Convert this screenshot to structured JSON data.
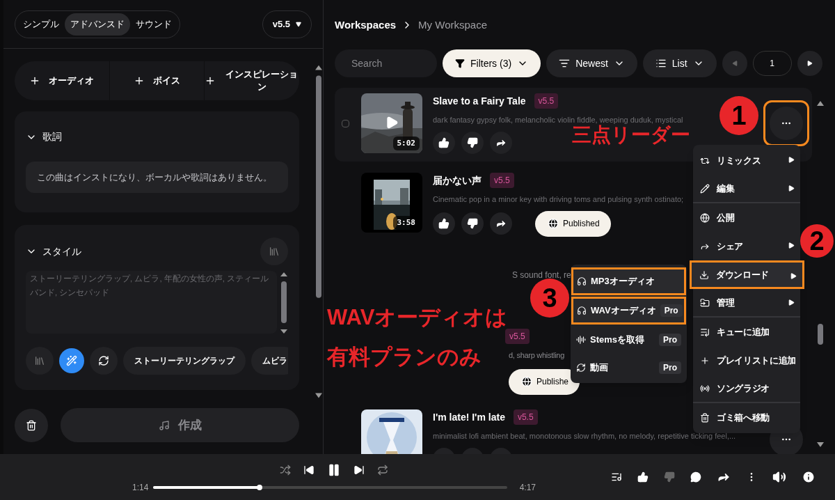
{
  "left_panel": {
    "modes": [
      {
        "label": "シンプル",
        "selected": false
      },
      {
        "label": "アドバンスド",
        "selected": true
      },
      {
        "label": "サウンド",
        "selected": false
      }
    ],
    "model_select": "v5.5",
    "add_buttons": [
      {
        "label": "オーディオ"
      },
      {
        "label": "ボイス"
      },
      {
        "label": "インスピレーション"
      }
    ],
    "lyrics": {
      "title": "歌詞",
      "expanded": true,
      "value": "この曲はインストになり、ボーカルや歌詞はありません。"
    },
    "style": {
      "title": "スタイル",
      "expanded": true,
      "placeholder": "ストーリーテリングラップ, ムビラ, 年配の女性の声, スティールバンド, シンセパッド",
      "tags": [
        "ストーリーテリングラップ",
        "ムビラ"
      ]
    },
    "create_button": "作成"
  },
  "breadcrumb": [
    "Workspaces",
    "My Workspace"
  ],
  "toolbar": {
    "search_placeholder": "Search",
    "filters": "Filters (3)",
    "sort": "Newest",
    "view": "List",
    "page": "1"
  },
  "songs": [
    {
      "kind": "full",
      "title": "Slave to a Fairy Tale",
      "version": "v5.5",
      "description": "dark fantasy gypsy folk, melancholic violin fiddle, weeping duduk, mystical",
      "duration": "5:02",
      "checked": false,
      "published": false,
      "menu_highlighted": true
    },
    {
      "kind": "full",
      "title": "届かない声",
      "version": "v5.5",
      "description": "Cinematic pop in a minor key with driving toms and pulsing synth ostinato;",
      "duration": "3:58",
      "published": true,
      "published_label": "Published"
    },
    {
      "kind": "fragment",
      "description": "S sound font, re"
    },
    {
      "kind": "partial",
      "version": "v5.5",
      "description": "d, sharp whistling",
      "published": true,
      "published_label": "Publishe"
    },
    {
      "kind": "clipped",
      "title": "I'm late! I'm late",
      "version": "v5.5",
      "description": "minimalist lofi ambient beat, monotonous slow rhythm, no melody, repetitive ticking feel,...",
      "published": false,
      "menu_highlighted": false
    }
  ],
  "context_menu": [
    {
      "label": "リミックス",
      "submenu": true,
      "highlighted": false,
      "divider_after": false
    },
    {
      "label": "編集",
      "submenu": true,
      "highlighted": false,
      "divider_after": true
    },
    {
      "label": "公開",
      "submenu": false,
      "highlighted": false,
      "divider_after": false
    },
    {
      "label": "シェア",
      "submenu": true,
      "highlighted": false,
      "divider_after": false
    },
    {
      "label": "ダウンロード",
      "submenu": true,
      "highlighted": true,
      "divider_after": false
    },
    {
      "label": "管理",
      "submenu": true,
      "highlighted": false,
      "divider_after": true
    },
    {
      "label": "キューに追加",
      "submenu": false,
      "highlighted": false,
      "divider_after": false
    },
    {
      "label": "プレイリストに追加",
      "submenu": false,
      "highlighted": false,
      "divider_after": false
    },
    {
      "label": "ソングラジオ",
      "submenu": false,
      "highlighted": false,
      "divider_after": true
    },
    {
      "label": "ゴミ箱へ移動",
      "submenu": false,
      "highlighted": false,
      "divider_after": false
    }
  ],
  "download_submenu": [
    {
      "label": "MP3オーディオ",
      "highlighted": true
    },
    {
      "label": "WAVオーディオ",
      "badge": "Pro",
      "highlighted": true
    },
    {
      "label": "Stemsを取得",
      "badge": "Pro",
      "highlighted": false
    },
    {
      "label": "動画",
      "badge": "Pro",
      "highlighted": false
    }
  ],
  "annotations": {
    "callouts": [
      "三点リーダー",
      "WAVオーディオは",
      "有料プランのみ"
    ],
    "steps": [
      "1",
      "2",
      "3"
    ]
  },
  "player": {
    "elapsed": "1:14",
    "duration": "4:17",
    "level": 0.3,
    "playing": true
  }
}
